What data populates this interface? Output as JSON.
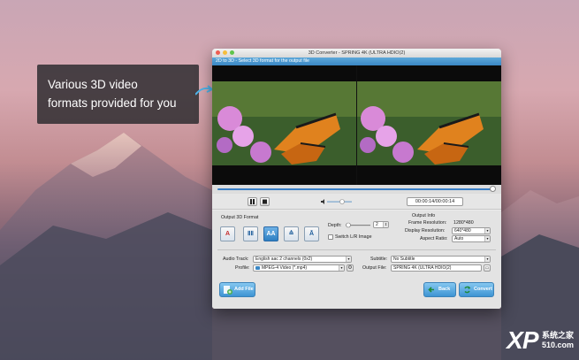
{
  "callout": {
    "line1": "Various 3D video",
    "line2": "formats provided for you"
  },
  "window": {
    "title": "3D Converter - SPRING 4K (ULTRA HDIO(2)",
    "subtitle": "2D to 3D - Select 3D format for the output file"
  },
  "player": {
    "time": "00:00:14/00:00:14",
    "pause_icon": "pause-icon",
    "stop_icon": "stop-icon",
    "volume_icon": "speaker-icon"
  },
  "format": {
    "heading": "Output 3D Format",
    "depth_label": "Depth:",
    "depth_value": "2",
    "switch_label": "Switch L/R Image"
  },
  "output_info": {
    "heading": "Output Info",
    "frame_res_label": "Frame Resolution:",
    "frame_res_value": "1280*480",
    "display_res_label": "Display Resolution:",
    "display_res_value": "640*480",
    "aspect_label": "Aspect Ratio:",
    "aspect_value": "Auto"
  },
  "fields": {
    "audio_label": "Audio Track:",
    "audio_value": "English aac 2 channels (0x2)",
    "profile_label": "Profile:",
    "profile_value": "MPEG-4 Video (*.mp4)",
    "subtitle_label": "Subtitle:",
    "subtitle_value": "No Subtitle",
    "output_label": "Output File:",
    "output_value": "SPRING 4K (ULTRA HDIO(2)"
  },
  "buttons": {
    "add_file": "Add File",
    "back": "Back",
    "convert": "Convert"
  },
  "watermark": {
    "brand": "XP",
    "sub": "系统之家",
    "num": "510.com"
  },
  "colors": {
    "accent": "#3e94d3",
    "subbar": "#3a87c4"
  }
}
